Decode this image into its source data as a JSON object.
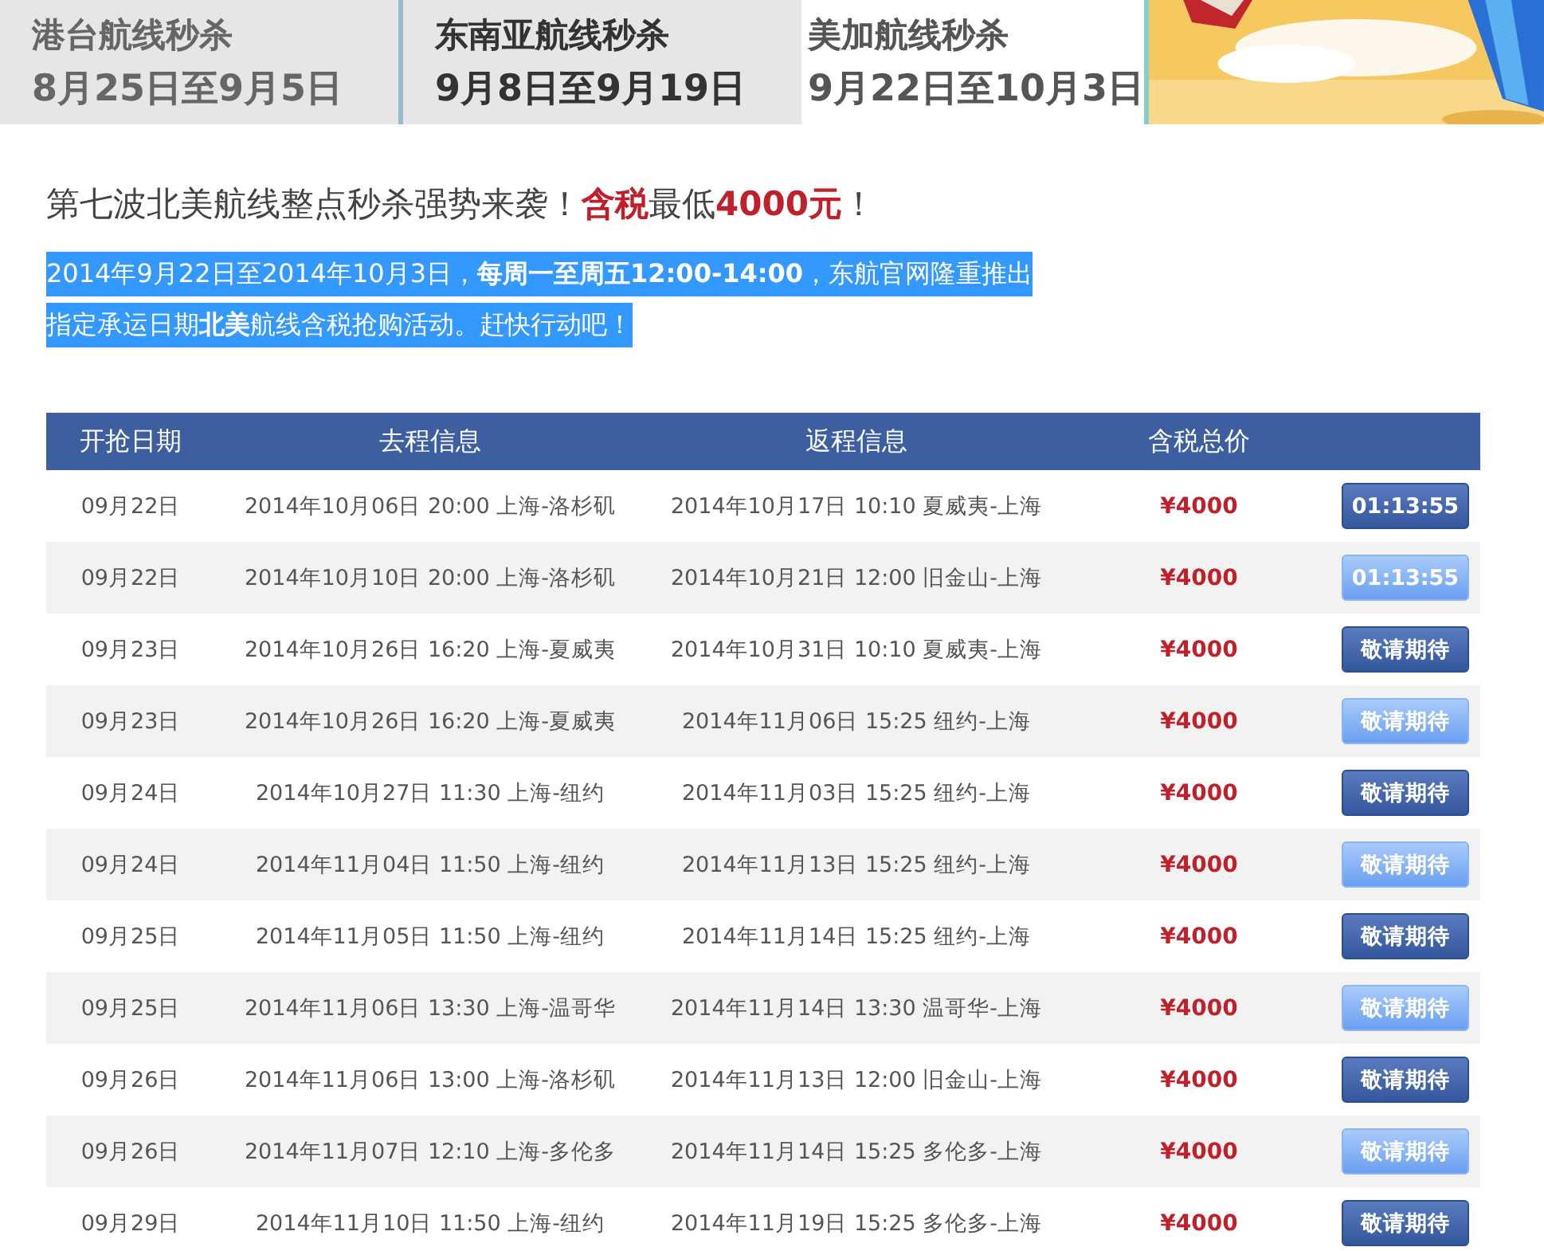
{
  "tabs": [
    {
      "title": "港台航线秒杀",
      "dates": "8月25日至9月5日",
      "selected": false
    },
    {
      "title": "东南亚航线秒杀",
      "dates": "9月8日至9月19日",
      "selected": false
    },
    {
      "title": "美加航线秒杀",
      "dates": "9月22日至10月3日",
      "selected": true
    }
  ],
  "headline": "第七波北美航线整点秒杀强势来袭！**含税**最低**4000元**！",
  "intro": {
    "highlighted": true,
    "lines": [
      "2014年9月22日至2014年10月3日，**每周一至周五12:00-14:00**，东航官网隆重推出",
      "指定承运日期**北美**航线含税抢购活动。赶快行动吧！"
    ]
  },
  "table": {
    "columns": [
      "开抢日期",
      "去程信息",
      "返程信息",
      "含税总价"
    ],
    "rows": [
      {
        "date": "09月22日",
        "outbound": "2014年10月06日 20:00 上海-洛杉矶",
        "return": "2014年10月17日 10:10 夏威夷-上海",
        "price": "¥4000",
        "button": {
          "label": "01:13:55",
          "kind": "dark"
        }
      },
      {
        "date": "09月22日",
        "outbound": "2014年10月10日 20:00 上海-洛杉矶",
        "return": "2014年10月21日 12:00 旧金山-上海",
        "price": "¥4000",
        "button": {
          "label": "01:13:55",
          "kind": "light"
        }
      },
      {
        "date": "09月23日",
        "outbound": "2014年10月26日 16:20 上海-夏威夷",
        "return": "2014年10月31日 10:10 夏威夷-上海",
        "price": "¥4000",
        "button": {
          "label": "敬请期待",
          "kind": "dark"
        }
      },
      {
        "date": "09月23日",
        "outbound": "2014年10月26日 16:20 上海-夏威夷",
        "return": "2014年11月06日 15:25 纽约-上海",
        "price": "¥4000",
        "button": {
          "label": "敬请期待",
          "kind": "light"
        }
      },
      {
        "date": "09月24日",
        "outbound": "2014年10月27日 11:30 上海-纽约",
        "return": "2014年11月03日 15:25 纽约-上海",
        "price": "¥4000",
        "button": {
          "label": "敬请期待",
          "kind": "dark"
        }
      },
      {
        "date": "09月24日",
        "outbound": "2014年11月04日 11:50 上海-纽约",
        "return": "2014年11月13日 15:25 纽约-上海",
        "price": "¥4000",
        "button": {
          "label": "敬请期待",
          "kind": "light"
        }
      },
      {
        "date": "09月25日",
        "outbound": "2014年11月05日 11:50 上海-纽约",
        "return": "2014年11月14日 15:25 纽约-上海",
        "price": "¥4000",
        "button": {
          "label": "敬请期待",
          "kind": "dark"
        }
      },
      {
        "date": "09月25日",
        "outbound": "2014年11月06日 13:30 上海-温哥华",
        "return": "2014年11月14日 13:30 温哥华-上海",
        "price": "¥4000",
        "button": {
          "label": "敬请期待",
          "kind": "light"
        }
      },
      {
        "date": "09月26日",
        "outbound": "2014年11月06日 13:00 上海-洛杉矶",
        "return": "2014年11月13日 12:00 旧金山-上海",
        "price": "¥4000",
        "button": {
          "label": "敬请期待",
          "kind": "dark"
        }
      },
      {
        "date": "09月26日",
        "outbound": "2014年11月07日 12:10 上海-多伦多",
        "return": "2014年11月14日 15:25 多伦多-上海",
        "price": "¥4000",
        "button": {
          "label": "敬请期待",
          "kind": "light"
        }
      },
      {
        "date": "09月29日",
        "outbound": "2014年11月10日 11:50 上海-纽约",
        "return": "2014年11月19日 15:25 多伦多-上海",
        "price": "¥4000",
        "button": {
          "label": "敬请期待",
          "kind": "dark"
        }
      }
    ]
  }
}
